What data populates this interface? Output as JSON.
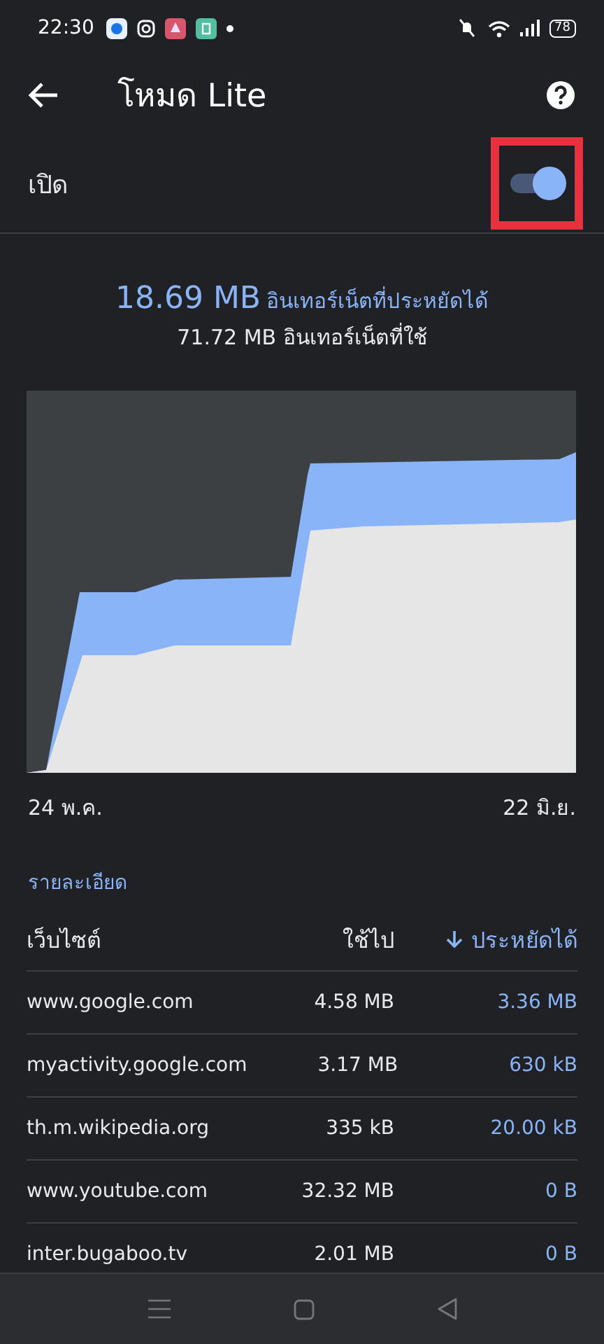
{
  "status_bar": {
    "time": "22:30",
    "battery": "78"
  },
  "header": {
    "title": "โหมด Lite"
  },
  "toggle_row": {
    "label": "เปิด",
    "on": true,
    "highlighted": true
  },
  "summary": {
    "saved_amount": "18.69 MB",
    "saved_label": "อินเทอร์เน็ตที่ประหยัดได้",
    "used": "71.72 MB อินเทอร์เน็ตที่ใช้"
  },
  "chart": {
    "kind": "picture",
    "start_label": "24 พ.ค.",
    "end_label": "22 มิ.ย."
  },
  "details_link": "รายละเอียด",
  "table": {
    "columns": [
      {
        "label": "เว็บไซต์",
        "sorted": false
      },
      {
        "label": "ใช้ไป",
        "sorted": false
      },
      {
        "label": "ประหยัดได้",
        "sorted": true
      }
    ],
    "rows": [
      {
        "site": "www.google.com",
        "used": "4.58 MB",
        "saved": "3.36 MB"
      },
      {
        "site": "myactivity.google.com",
        "used": "3.17 MB",
        "saved": "630 kB"
      },
      {
        "site": "th.m.wikipedia.org",
        "used": "335 kB",
        "saved": "20.00 kB"
      },
      {
        "site": "www.youtube.com",
        "used": "32.32 MB",
        "saved": "0 B"
      },
      {
        "site": "inter.bugaboo.tv",
        "used": "2.01 MB",
        "saved": "0 B"
      }
    ]
  }
}
